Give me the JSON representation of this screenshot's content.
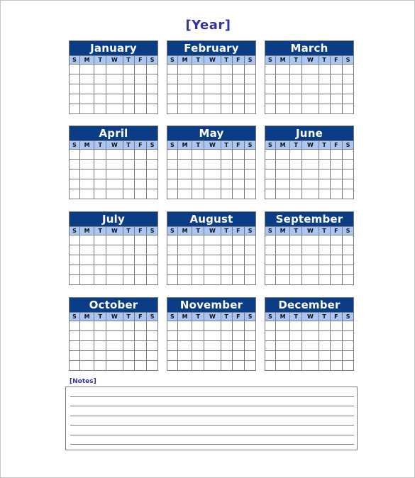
{
  "title": "[Year]",
  "weekday_labels": [
    "S",
    "M",
    "T",
    "W",
    "T",
    "F",
    "S"
  ],
  "weeks_per_month": 5,
  "months": [
    {
      "name": "January"
    },
    {
      "name": "February"
    },
    {
      "name": "March"
    },
    {
      "name": "April"
    },
    {
      "name": "May"
    },
    {
      "name": "June"
    },
    {
      "name": "July"
    },
    {
      "name": "August"
    },
    {
      "name": "September"
    },
    {
      "name": "October"
    },
    {
      "name": "November"
    },
    {
      "name": "December"
    }
  ],
  "notes": {
    "label": "[Notes]",
    "line_count": 6
  },
  "colors": {
    "header_bg": "#0a3d86",
    "weekday_bg": "#a9c6f5",
    "title_text": "#3333a0",
    "grid_line": "#7a7a7a"
  }
}
